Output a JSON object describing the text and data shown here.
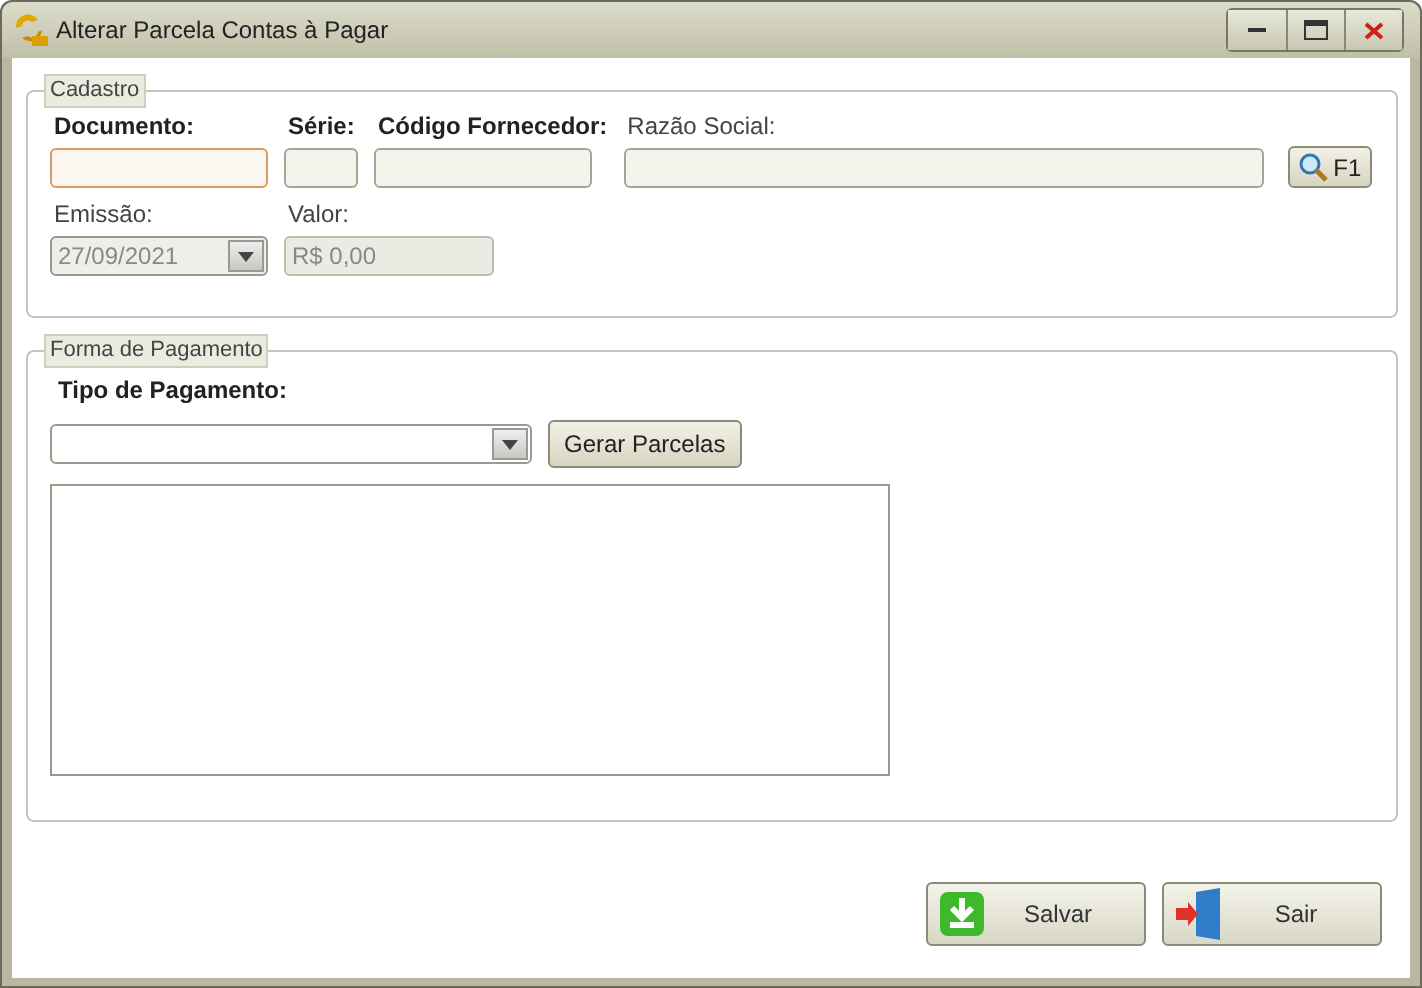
{
  "window": {
    "title": "Alterar Parcela Contas à Pagar"
  },
  "cadastro": {
    "legend": "Cadastro",
    "rows": [
      [
        {
          "label": "Documento:",
          "bold": true,
          "kind": "text",
          "focused": true,
          "disabled": false
        },
        {
          "label": "Série:",
          "bold": true,
          "kind": "text",
          "focused": false,
          "disabled": false
        },
        {
          "label": "Código Fornecedor:",
          "bold": true,
          "kind": "text",
          "focused": false,
          "disabled": false
        },
        {
          "label": "Razão Social:",
          "bold": false,
          "kind": "text",
          "focused": false,
          "disabled": false
        },
        {
          "kind": "search",
          "label": "F1"
        }
      ],
      [
        {
          "label": "Emissão:",
          "bold": false,
          "kind": "date",
          "value": "27/09/2021",
          "focused": false,
          "disabled": true
        },
        {
          "label": "Valor:",
          "bold": false,
          "kind": "text",
          "value": "R$ 0,00",
          "focused": false,
          "disabled": true
        }
      ]
    ]
  },
  "pagamento": {
    "legend": "Forma de Pagamento",
    "label": "Tipo de Pagamento:",
    "button": "Gerar Parcelas"
  },
  "buttons": [
    {
      "label": "Salvar",
      "kind": "save"
    },
    {
      "label": "Sair",
      "kind": "exit"
    }
  ]
}
